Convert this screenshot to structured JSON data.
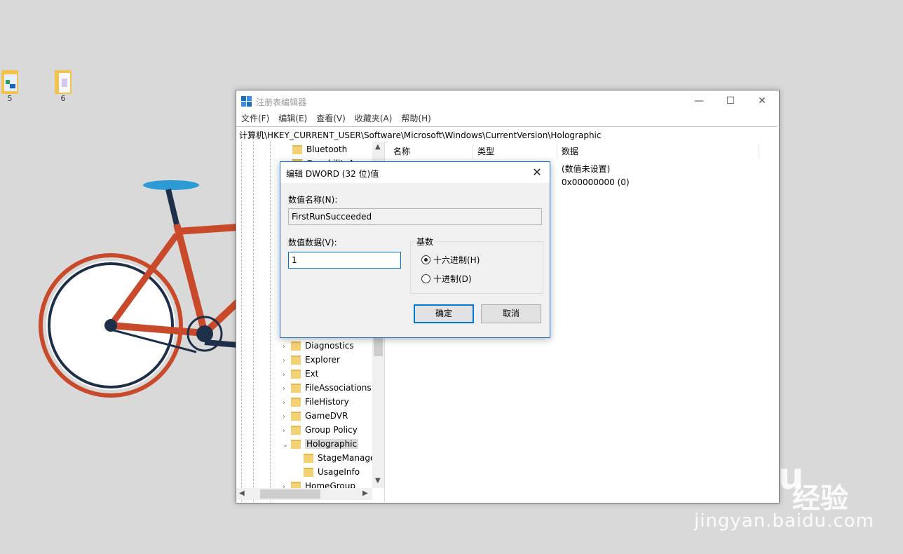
{
  "desktop": {
    "icons": [
      {
        "label": "5",
        "icon": "folder-icon"
      },
      {
        "label": "6",
        "icon": "folder-icon"
      }
    ],
    "watermark": {
      "logo": "Baidu",
      "cn": "经验",
      "url": "jingyan.baidu.com"
    }
  },
  "regedit": {
    "title": "注册表编辑器",
    "menu": [
      "文件(F)",
      "编辑(E)",
      "查看(V)",
      "收藏夹(A)",
      "帮助(H)"
    ],
    "address": "计算机\\HKEY_CURRENT_USER\\Software\\Microsoft\\Windows\\CurrentVersion\\Holographic",
    "tree": {
      "top_items": [
        "Bluetooth",
        "CapabilityAc"
      ],
      "items": [
        {
          "label": "Diagnostics",
          "expanded": false
        },
        {
          "label": "Explorer",
          "expanded": false
        },
        {
          "label": "Ext",
          "expanded": false
        },
        {
          "label": "FileAssociations",
          "expanded": false
        },
        {
          "label": "FileHistory",
          "expanded": false
        },
        {
          "label": "GameDVR",
          "expanded": false
        },
        {
          "label": "Group Policy",
          "expanded": false
        },
        {
          "label": "Holographic",
          "expanded": true,
          "selected": true
        }
      ],
      "children": [
        "StageManage",
        "UsageInfo"
      ],
      "last": "HomeGroup"
    },
    "list": {
      "columns": [
        "名称",
        "类型",
        "数据"
      ],
      "rows": [
        {
          "data": "(数值未设置)"
        },
        {
          "data": "0x00000000 (0)"
        }
      ]
    }
  },
  "dialog": {
    "title": "编辑 DWORD (32 位)值",
    "name_label": "数值名称(N):",
    "name_value": "FirstRunSucceeded",
    "data_label": "数值数据(V):",
    "data_value": "1",
    "base_label": "基数",
    "radio_hex": "十六进制(H)",
    "radio_dec": "十进制(D)",
    "selected_base": "hex",
    "ok": "确定",
    "cancel": "取消"
  }
}
